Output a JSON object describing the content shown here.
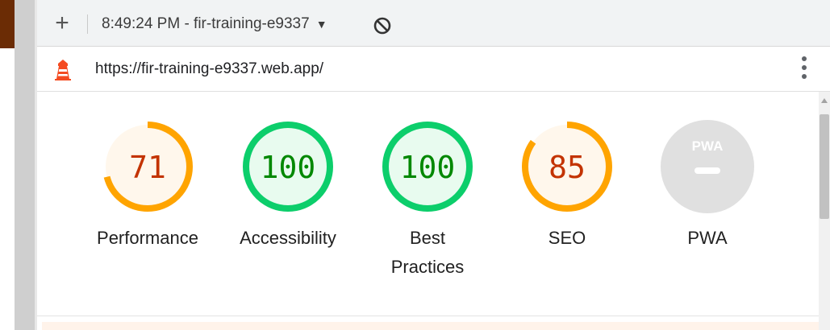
{
  "toolbar": {
    "new_label": "+",
    "report_title": "8:49:24 PM - fir-training-e9337",
    "caret": "▼"
  },
  "urlbar": {
    "url": "https://fir-training-e9337.web.app/"
  },
  "colors": {
    "average": "#ffa400",
    "average_text": "#c33300",
    "average_fill": "#fff7ec",
    "pass": "#0cce6b",
    "pass_text": "#008800",
    "pass_fill": "#e8fbef",
    "na": "#e0e0e0"
  },
  "gauges": [
    {
      "label": "Performance",
      "score": "71",
      "status": "average",
      "fraction": 0.71
    },
    {
      "label": "Accessibility",
      "score": "100",
      "status": "pass",
      "fraction": 1.0
    },
    {
      "label_lines": [
        "Best",
        "Practices"
      ],
      "score": "100",
      "status": "pass",
      "fraction": 1.0
    },
    {
      "label": "SEO",
      "score": "85",
      "status": "average",
      "fraction": 0.85
    },
    {
      "label": "PWA",
      "badge": "PWA",
      "status": "na",
      "icon": "pwa-badge-icon"
    }
  ]
}
